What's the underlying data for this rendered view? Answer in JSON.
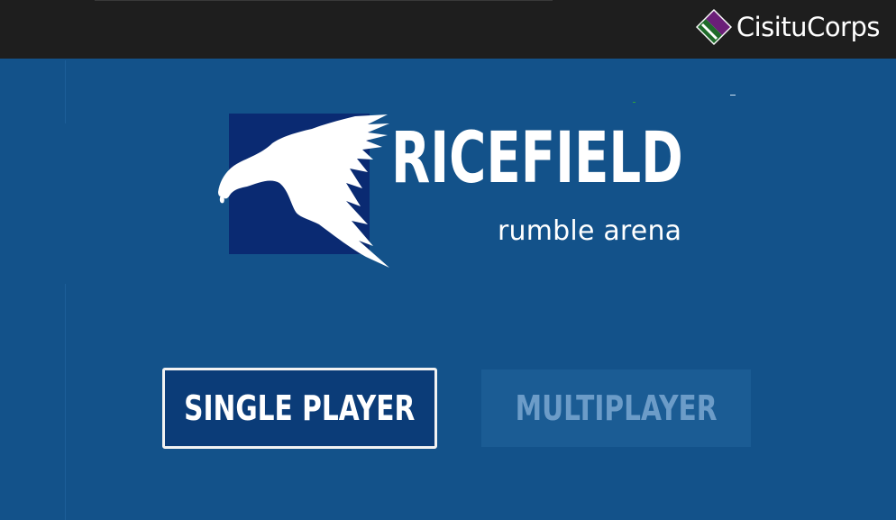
{
  "header": {
    "brand_name": "CisituCorps",
    "brand_icon": "diamond-logo-icon"
  },
  "logo": {
    "title": "RICEFIELD",
    "subtitle": "rumble arena",
    "icon": "eagle-icon"
  },
  "menu": {
    "single_player_label": "SINGLE PLAYER",
    "multiplayer_label": "MULTIPLAYER",
    "multiplayer_state": "disabled"
  },
  "colors": {
    "background": "#13528a",
    "topbar": "#1e1e1e",
    "logo_square": "#0a2a72",
    "single_button_bg": "#0b3c78",
    "multi_button_bg": "#1b5c94",
    "multi_button_text": "#6c9cc8",
    "brand_purple": "#6b1f78",
    "brand_green": "#1f6b2a"
  }
}
